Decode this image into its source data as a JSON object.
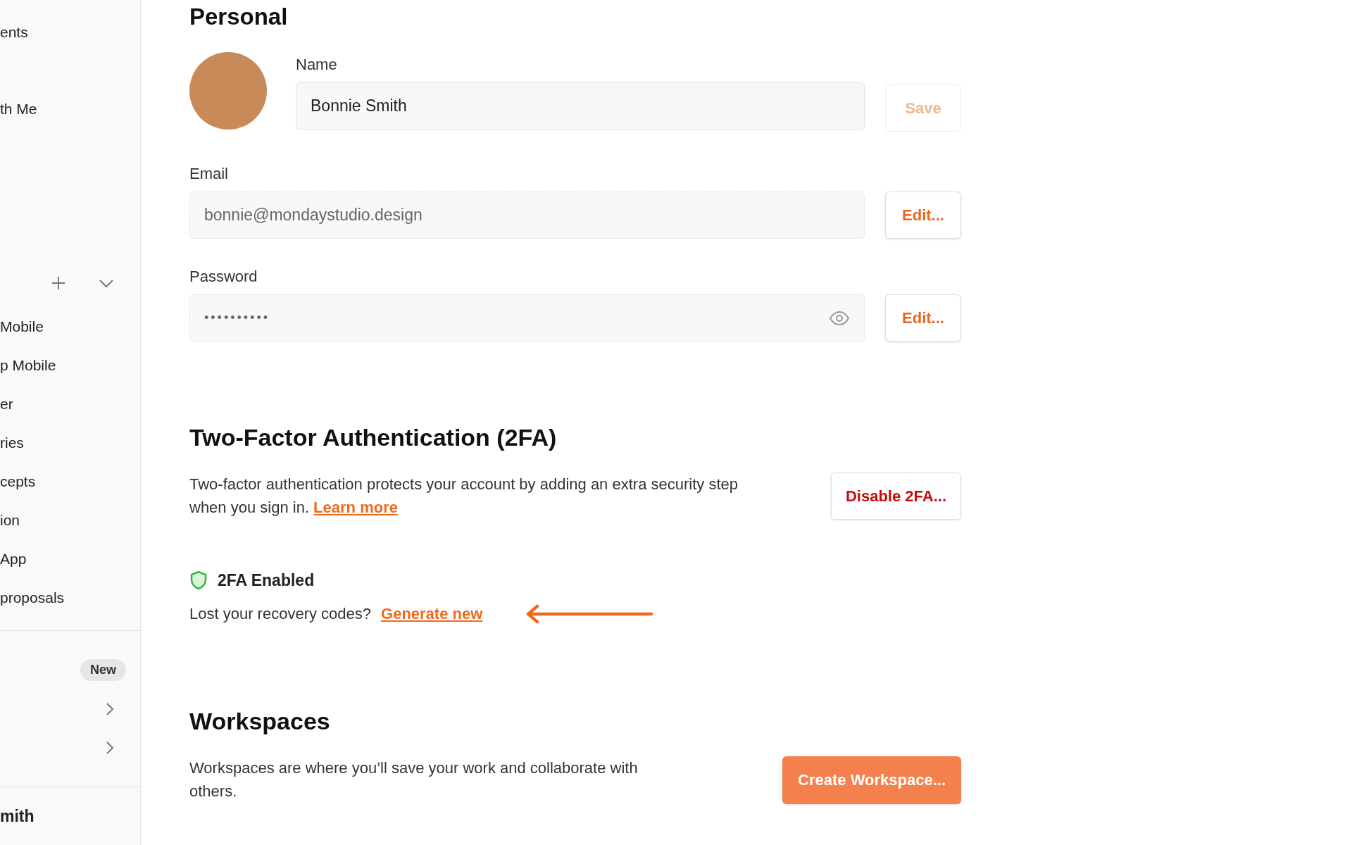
{
  "sidebar": {
    "top_items": [
      "ents",
      "th Me"
    ],
    "projects": [
      {
        "label": "Mobile"
      },
      {
        "label": "p Mobile"
      },
      {
        "label": "er"
      },
      {
        "label": "ries"
      },
      {
        "label": "cepts"
      },
      {
        "label": "ion"
      },
      {
        "label": "App"
      },
      {
        "label": "proposals"
      }
    ],
    "extra_rows": [
      {
        "kind": "badge",
        "badge": "New"
      },
      {
        "kind": "expandable"
      },
      {
        "kind": "expandable"
      }
    ],
    "user": "mith"
  },
  "personal": {
    "heading": "Personal",
    "name_label": "Name",
    "name_value": "Bonnie Smith",
    "save_button": {
      "label": "Save",
      "disabled": true
    },
    "email_label": "Email",
    "email_value": "bonnie@mondaystudio.design",
    "email_button": "Edit...",
    "password_label": "Password",
    "password_value": "••••••••••",
    "password_button": "Edit..."
  },
  "two_factor": {
    "heading": "Two-Factor Authentication (2FA)",
    "description": "Two-factor authentication protects your account by adding an extra security step when you sign in.",
    "learn_more": "Learn more",
    "disable_button": "Disable 2FA...",
    "enabled": true,
    "status": "2FA Enabled",
    "recovery_text": "Lost your recovery codes?",
    "recovery_link": "Generate new"
  },
  "workspaces": {
    "heading": "Workspaces",
    "description": "Workspaces are where you’ll save your work and collaborate with others.",
    "create_button": "Create Workspace..."
  }
}
